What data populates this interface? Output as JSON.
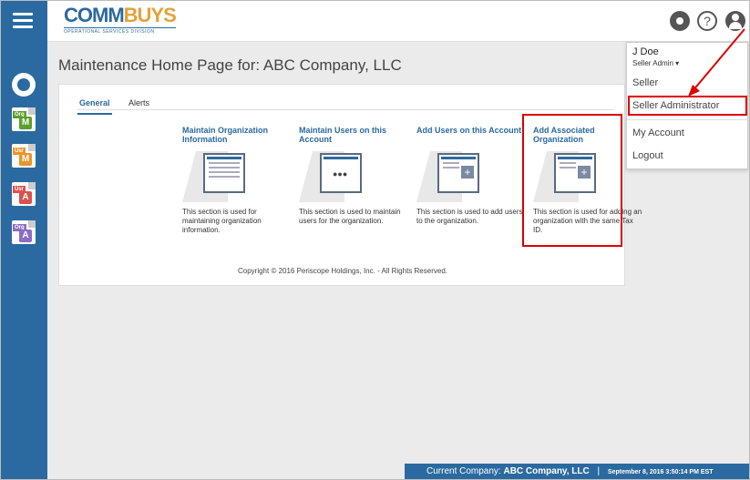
{
  "header": {
    "logo_main_a": "COMM",
    "logo_main_b": "BUYS",
    "logo_sub": "OPERATIONAL SERVICES DIVISION",
    "help_glyph": "?"
  },
  "sidebar": {
    "icons": [
      {
        "name": "dashboard-icon"
      },
      {
        "name": "org-document-icon",
        "tag": "Org",
        "badge": "M",
        "color": "#5aa02c"
      },
      {
        "name": "user-document-icon",
        "tag": "Usr",
        "badge": "M",
        "color": "#e8952c"
      },
      {
        "name": "user-admin-document-icon",
        "tag": "Usr",
        "badge": "A",
        "color": "#d9534f"
      },
      {
        "name": "org-admin-document-icon",
        "tag": "Org",
        "badge": "A",
        "color": "#8c6cc4"
      }
    ]
  },
  "page": {
    "title": "Maintenance Home Page for: ABC Company, LLC"
  },
  "tabs": [
    {
      "label": "General",
      "active": true
    },
    {
      "label": "Alerts",
      "active": false
    }
  ],
  "tiles": [
    {
      "title": "Maintain Organization Information",
      "description": "This section is used for maintaining organization information."
    },
    {
      "title": "Maintain Users on this Account",
      "description": "This section is used to maintain users for the organization."
    },
    {
      "title": "Add Users on this Account",
      "description": "This section is used to add users to the organization."
    },
    {
      "title": "Add Associated Organization",
      "description": "This section is used for adding an organization with the same Tax ID."
    }
  ],
  "copyright": "Copyright © 2016 Periscope Holdings, Inc. - All Rights Reserved.",
  "user_menu": {
    "name": "J Doe",
    "role": "Seller Admin ▾",
    "items": [
      "Seller",
      "Seller Administrator",
      "My Account",
      "Logout"
    ]
  },
  "status": {
    "company_label": "Current Company:",
    "company_name": "ABC Company, LLC",
    "separator": "|",
    "timestamp": "September 8, 2016 3:50:14 PM EST"
  },
  "colors": {
    "brand_blue": "#2b6aa0",
    "brand_orange": "#e4a23c",
    "highlight_red": "#dd0000"
  }
}
